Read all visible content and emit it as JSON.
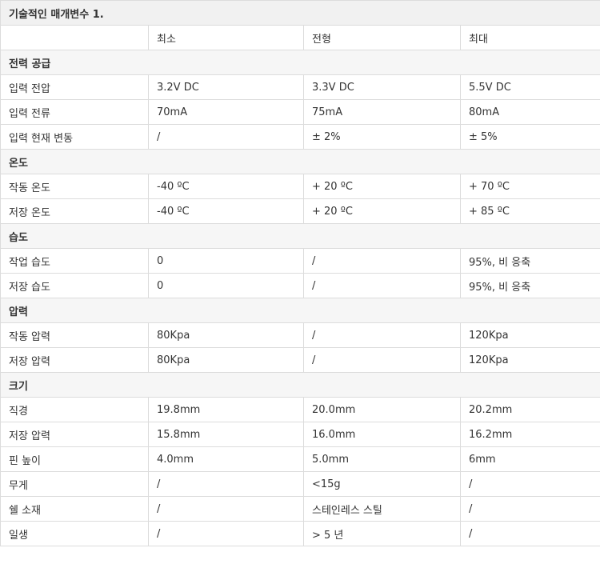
{
  "caption": "기술적인 매개변수 1.",
  "header": [
    "",
    "최소",
    "전형",
    "최대"
  ],
  "sections": [
    {
      "title": "전력 공급",
      "rows": [
        [
          "입력 전압",
          "3.2V DC",
          "3.3V DC",
          "5.5V DC"
        ],
        [
          "입력 전류",
          "70mA",
          "75mA",
          "80mA"
        ],
        [
          "입력 현재 변동",
          "/",
          "± 2%",
          "± 5%"
        ]
      ]
    },
    {
      "title": "온도",
      "rows": [
        [
          "작동 온도",
          "-40 ºC",
          "+ 20 ºC",
          "+ 70 ºC"
        ],
        [
          "저장 온도",
          "-40 ºC",
          "+ 20 ºC",
          "+ 85 ºC"
        ]
      ]
    },
    {
      "title": "습도",
      "rows": [
        [
          "작업 습도",
          "0",
          "/",
          "95%, 비 응축"
        ],
        [
          "저장 습도",
          "0",
          "/",
          "95%, 비 응축"
        ]
      ]
    },
    {
      "title": "압력",
      "rows": [
        [
          "작동 압력",
          "80Kpa",
          "/",
          "120Kpa"
        ],
        [
          "저장 압력",
          "80Kpa",
          "/",
          "120Kpa"
        ]
      ]
    },
    {
      "title": "크기",
      "rows": [
        [
          "직경",
          "19.8mm",
          "20.0mm",
          "20.2mm"
        ],
        [
          "저장 압력",
          "15.8mm",
          "16.0mm",
          "16.2mm"
        ],
        [
          "핀 높이",
          "4.0mm",
          "5.0mm",
          "6mm"
        ],
        [
          "무게",
          "/",
          "<15g",
          "/"
        ],
        [
          "쉘 소재",
          "/",
          "스테인레스 스틸",
          "/"
        ],
        [
          "일생",
          "/",
          "> 5 년",
          "/"
        ]
      ]
    }
  ]
}
